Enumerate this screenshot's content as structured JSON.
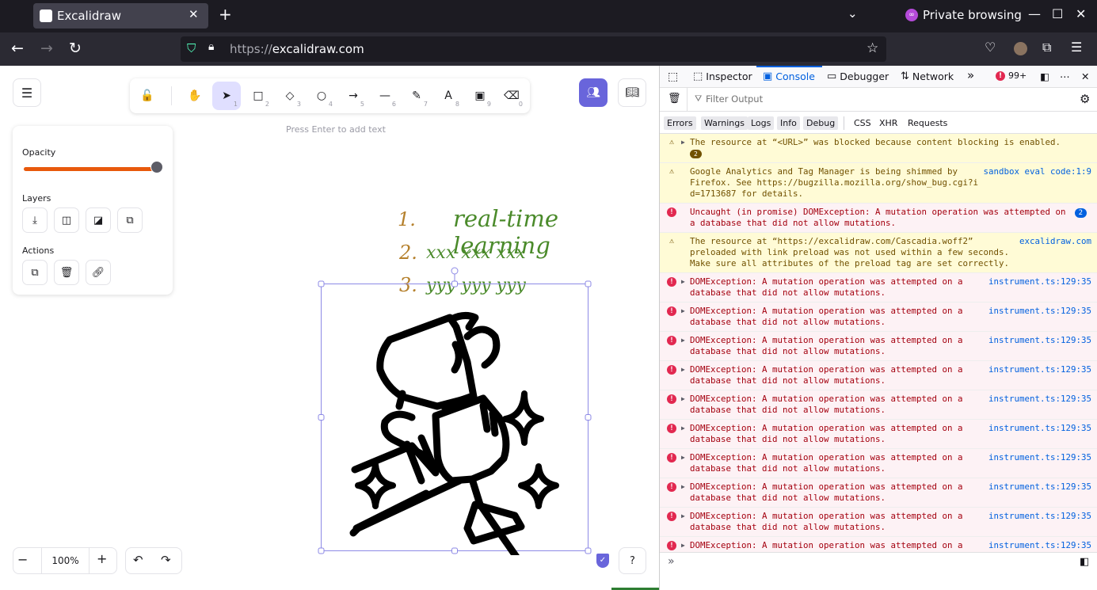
{
  "browser": {
    "tab_title": "Excalidraw",
    "url_scheme": "https://",
    "url_host": "excalidraw.com",
    "private_label": "Private browsing"
  },
  "toolbar": {
    "tools": [
      {
        "name": "lock-tool",
        "icon": "lock-icon",
        "glyph": "🔓",
        "key": ""
      },
      {
        "name": "hand-tool",
        "icon": "hand-icon",
        "glyph": "✋",
        "key": ""
      },
      {
        "name": "selection-tool",
        "icon": "pointer-icon",
        "glyph": "➤",
        "key": "1"
      },
      {
        "name": "rectangle-tool",
        "icon": "rectangle-icon",
        "glyph": "□",
        "key": "2"
      },
      {
        "name": "diamond-tool",
        "icon": "diamond-icon",
        "glyph": "◇",
        "key": "3"
      },
      {
        "name": "ellipse-tool",
        "icon": "ellipse-icon",
        "glyph": "○",
        "key": "4"
      },
      {
        "name": "arrow-tool",
        "icon": "arrow-icon",
        "glyph": "→",
        "key": "5"
      },
      {
        "name": "line-tool",
        "icon": "line-icon",
        "glyph": "—",
        "key": "6"
      },
      {
        "name": "draw-tool",
        "icon": "pencil-icon",
        "glyph": "✎",
        "key": "7"
      },
      {
        "name": "text-tool",
        "icon": "text-icon",
        "glyph": "A",
        "key": "8"
      },
      {
        "name": "image-tool",
        "icon": "image-icon",
        "glyph": "▣",
        "key": "9"
      },
      {
        "name": "eraser-tool",
        "icon": "eraser-icon",
        "glyph": "⌫",
        "key": "0"
      }
    ],
    "hint": "Press Enter to add text"
  },
  "props": {
    "opacity_label": "Opacity",
    "opacity_value": 1.0,
    "layers_label": "Layers",
    "actions_label": "Actions"
  },
  "canvas": {
    "list_numbers": [
      "1.",
      "2.",
      "3."
    ],
    "line1": "real-time learning",
    "line2": "xxx xxx xxx",
    "line3": "yyy yyy yyy"
  },
  "footer": {
    "zoom": "100%"
  },
  "devtools": {
    "tabs": {
      "inspector": "Inspector",
      "console": "Console",
      "debugger": "Debugger",
      "network": "Network"
    },
    "error_count": "99+",
    "filter_placeholder": "Filter Output",
    "levels": [
      "Errors",
      "Warnings",
      "Logs",
      "Info",
      "Debug"
    ],
    "categories": [
      "CSS",
      "XHR",
      "Requests"
    ]
  },
  "messages": [
    {
      "type": "warn",
      "expand": true,
      "lines": [
        "The resource at “<URL>” was blocked because content blocking is enabled."
      ],
      "count": "2",
      "src": ""
    },
    {
      "type": "warn",
      "expand": false,
      "lines": [
        "Google Analytics and Tag Manager is being shimmed by",
        "Firefox. See https://bugzilla.mozilla.org/show_bug.cgi?i",
        "d=1713687 for details."
      ],
      "src": "sandbox eval code:1:9"
    },
    {
      "type": "err",
      "expand": false,
      "lines": [
        "Uncaught (in promise) DOMException: A mutation operation was attempted on",
        "a database that did not allow mutations."
      ],
      "badge": "2",
      "src": ""
    },
    {
      "type": "warn",
      "expand": false,
      "lines": [
        "The resource at “https://excalidraw.com/Cascadia.woff2”",
        "preloaded with link preload was not used within a few seconds.",
        "Make sure all attributes of the preload tag are set correctly."
      ],
      "src": "excalidraw.com"
    },
    {
      "type": "err",
      "expand": true,
      "lines": [
        "DOMException: A mutation operation was attempted on a",
        "database that did not allow mutations."
      ],
      "src": "instrument.ts:129:35"
    },
    {
      "type": "err",
      "expand": true,
      "lines": [
        "DOMException: A mutation operation was attempted on a",
        "database that did not allow mutations."
      ],
      "src": "instrument.ts:129:35"
    },
    {
      "type": "err",
      "expand": true,
      "lines": [
        "DOMException: A mutation operation was attempted on a",
        "database that did not allow mutations."
      ],
      "src": "instrument.ts:129:35"
    },
    {
      "type": "err",
      "expand": true,
      "lines": [
        "DOMException: A mutation operation was attempted on a",
        "database that did not allow mutations."
      ],
      "src": "instrument.ts:129:35"
    },
    {
      "type": "err",
      "expand": true,
      "lines": [
        "DOMException: A mutation operation was attempted on a",
        "database that did not allow mutations."
      ],
      "src": "instrument.ts:129:35"
    },
    {
      "type": "err",
      "expand": true,
      "lines": [
        "DOMException: A mutation operation was attempted on a",
        "database that did not allow mutations."
      ],
      "src": "instrument.ts:129:35"
    },
    {
      "type": "err",
      "expand": true,
      "lines": [
        "DOMException: A mutation operation was attempted on a",
        "database that did not allow mutations."
      ],
      "src": "instrument.ts:129:35"
    },
    {
      "type": "err",
      "expand": true,
      "lines": [
        "DOMException: A mutation operation was attempted on a",
        "database that did not allow mutations."
      ],
      "src": "instrument.ts:129:35"
    },
    {
      "type": "err",
      "expand": true,
      "lines": [
        "DOMException: A mutation operation was attempted on a",
        "database that did not allow mutations."
      ],
      "src": "instrument.ts:129:35"
    },
    {
      "type": "err",
      "expand": true,
      "lines": [
        "DOMException: A mutation operation was attempted on a",
        "database that did not allow mutations."
      ],
      "src": "instrument.ts:129:35"
    },
    {
      "type": "err",
      "expand": true,
      "lines": [
        "DOMException: A mutation operation was attempted on a",
        "database that did not allow mutations."
      ],
      "src": "instrument.ts:129:35"
    }
  ],
  "colors": {
    "accent": "#6965db",
    "number_color": "#b5802c",
    "text_green": "#4a8a2a",
    "opacity_slider": "#e8590c"
  }
}
